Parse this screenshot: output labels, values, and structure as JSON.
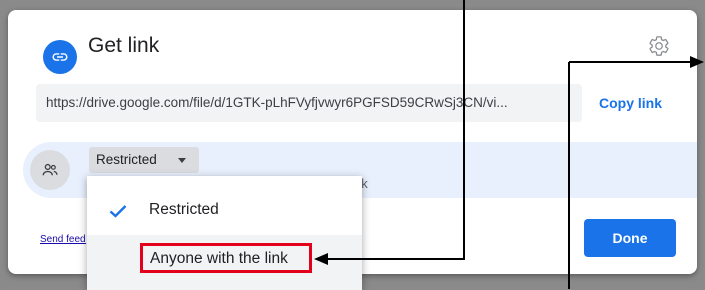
{
  "dialog": {
    "title": "Get link",
    "url": "https://drive.google.com/file/d/1GTK-pLhFVyfjvwyr6PGFSD59CRwSj3CN/vi...",
    "copy_link_label": "Copy link",
    "general_access": {
      "selected": "Restricted",
      "description_tail": "nk"
    },
    "send_feedback_label": "Send feedback",
    "done_label": "Done",
    "accent_color": "#1a73e8"
  },
  "dropdown": {
    "options": [
      {
        "label": "Restricted",
        "checked": true
      },
      {
        "label": "Anyone with the link",
        "checked": false
      }
    ]
  },
  "annotation": {
    "highlight_color": "#e3001b",
    "arrow_color": "#000000"
  }
}
